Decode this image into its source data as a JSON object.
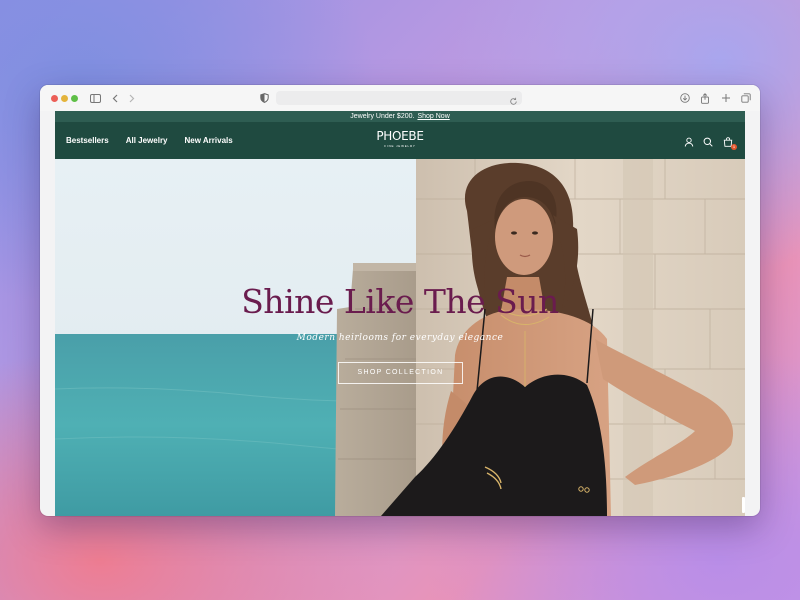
{
  "promo": {
    "text": "Jewelry Under $200.",
    "link": "Shop Now"
  },
  "nav": {
    "links": [
      "Bestsellers",
      "All Jewelry",
      "New Arrivals"
    ],
    "logo": "PHOEBE",
    "logo_sub": "FINE JEWELRY",
    "icons": [
      "account-icon",
      "search-icon",
      "cart-icon"
    ],
    "cart_count": "1"
  },
  "hero": {
    "title": "Shine Like The Sun",
    "subtitle": "Modern heirlooms for everyday elegance",
    "button": "SHOP COLLECTION"
  },
  "colors": {
    "promo_bg": "#2e5d52",
    "nav_bg": "#1f4a40",
    "title": "#6a1c4e",
    "badge": "#e4572e"
  }
}
